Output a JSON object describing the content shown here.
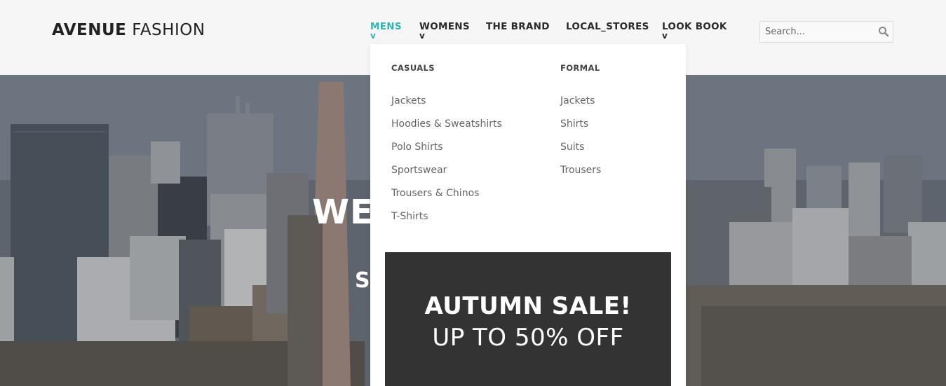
{
  "brand": {
    "bold": "AVENUE",
    "light": "FASHION"
  },
  "nav": [
    {
      "label": "MENS",
      "caret": "v"
    },
    {
      "label": "WOMENS",
      "caret": "v"
    },
    {
      "label": "THE BRAND",
      "caret": ""
    },
    {
      "label": "LOCAL_STORES",
      "caret": ""
    },
    {
      "label": "LOOK BOOK",
      "caret": "v"
    }
  ],
  "search": {
    "placeholder": "Search..."
  },
  "hero": {
    "title_visible": "WE",
    "sub_visible": "S"
  },
  "menu": {
    "casuals": {
      "heading": "CASUALS",
      "items": [
        "Jackets",
        "Hoodies & Sweatshirts",
        "Polo Shirts",
        "Sportswear",
        "Trousers & Chinos",
        "T-Shirts"
      ]
    },
    "formal": {
      "heading": "FORMAL",
      "items": [
        "Jackets",
        "Shirts",
        "Suits",
        "Trousers"
      ]
    }
  },
  "promo": {
    "line1": "AUTUMN SALE!",
    "line2": "UP TO 50% OFF"
  },
  "colors": {
    "accent": "#2fb5b5",
    "promo_bg": "#333333",
    "header_bg": "#f6f6f6"
  }
}
